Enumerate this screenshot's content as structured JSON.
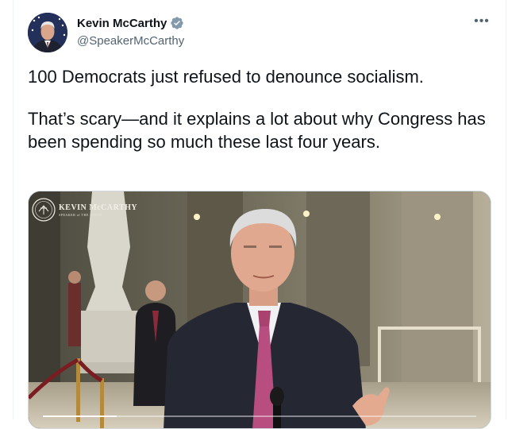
{
  "author": {
    "display_name": "Kevin McCarthy",
    "handle": "@SpeakerMcCarthy",
    "verified_icon": "verified-badge-icon",
    "verified_color": "#829aab"
  },
  "more_icon": "•••",
  "tweet": {
    "paragraphs": [
      "100 Democrats just refused to denounce socialism.",
      "That’s scary—and it explains a lot about why Congress has been spending so much these last four years."
    ]
  },
  "media": {
    "type": "video",
    "watermark_title": "KEVIN McCARTHY",
    "watermark_subtitle": "SPEAKER of THE HOUSE",
    "progress": 0.17
  }
}
